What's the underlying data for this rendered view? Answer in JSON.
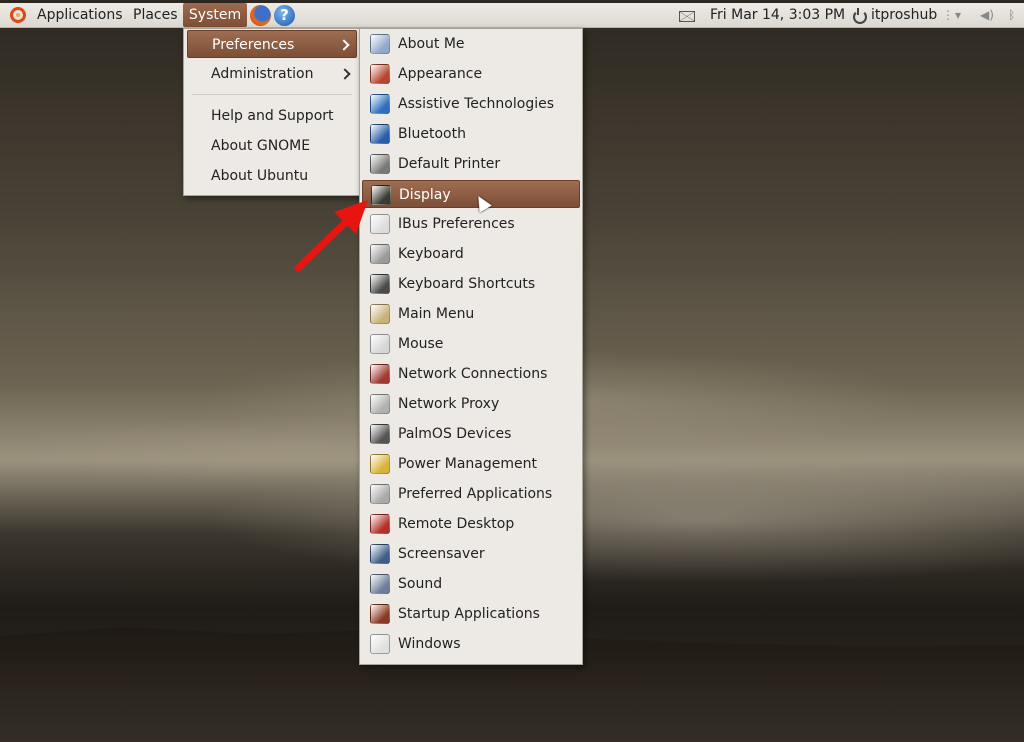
{
  "panel": {
    "applications": "Applications",
    "places": "Places",
    "system": "System",
    "help_icon_glyph": "?",
    "datetime": "Fri Mar 14,  3:03 PM",
    "username": "itproshub"
  },
  "system_menu": {
    "items": [
      {
        "label": "Preferences",
        "submenu": true,
        "highlighted": true
      },
      {
        "label": "Administration",
        "submenu": true
      },
      {
        "label": "Help and Support"
      },
      {
        "label": "About GNOME"
      },
      {
        "label": "About Ubuntu"
      }
    ]
  },
  "preferences_menu": {
    "items": [
      {
        "label": "About Me",
        "icon": "user-info-icon",
        "color": "#8fa9c9"
      },
      {
        "label": "Appearance",
        "icon": "appearance-icon",
        "color": "#b5472e"
      },
      {
        "label": "Assistive Technologies",
        "icon": "accessibility-icon",
        "color": "#2f6fbd"
      },
      {
        "label": "Bluetooth",
        "icon": "bluetooth-icon",
        "color": "#2a5fa8"
      },
      {
        "label": "Default Printer",
        "icon": "printer-icon",
        "color": "#7a7a7a"
      },
      {
        "label": "Display",
        "icon": "display-icon",
        "color": "#3b3b32",
        "highlighted": true
      },
      {
        "label": "IBus Preferences",
        "icon": "ibus-icon",
        "color": "#dcdcdc"
      },
      {
        "label": "Keyboard",
        "icon": "keyboard-icon",
        "color": "#9a9a9a"
      },
      {
        "label": "Keyboard Shortcuts",
        "icon": "keyboard-shortcuts-icon",
        "color": "#4a4a4a"
      },
      {
        "label": "Main Menu",
        "icon": "main-menu-icon",
        "color": "#c9b27a"
      },
      {
        "label": "Mouse",
        "icon": "mouse-icon",
        "color": "#d6d6d6"
      },
      {
        "label": "Network Connections",
        "icon": "network-connections-icon",
        "color": "#a03a32"
      },
      {
        "label": "Network Proxy",
        "icon": "network-proxy-icon",
        "color": "#b0b0b0"
      },
      {
        "label": "PalmOS Devices",
        "icon": "palm-device-icon",
        "color": "#555555"
      },
      {
        "label": "Power Management",
        "icon": "power-management-icon",
        "color": "#d8b23a"
      },
      {
        "label": "Preferred Applications",
        "icon": "preferred-apps-icon",
        "color": "#a9a9a9"
      },
      {
        "label": "Remote Desktop",
        "icon": "remote-desktop-icon",
        "color": "#b3312a"
      },
      {
        "label": "Screensaver",
        "icon": "screensaver-icon",
        "color": "#3f5f8a"
      },
      {
        "label": "Sound",
        "icon": "sound-icon",
        "color": "#6c7f9a"
      },
      {
        "label": "Startup Applications",
        "icon": "startup-apps-icon",
        "color": "#8a3a24"
      },
      {
        "label": "Windows",
        "icon": "windows-icon",
        "color": "#e0e0e0"
      }
    ]
  },
  "colors": {
    "highlight": "#8a5a40",
    "annotation_arrow": "#e8140f"
  }
}
